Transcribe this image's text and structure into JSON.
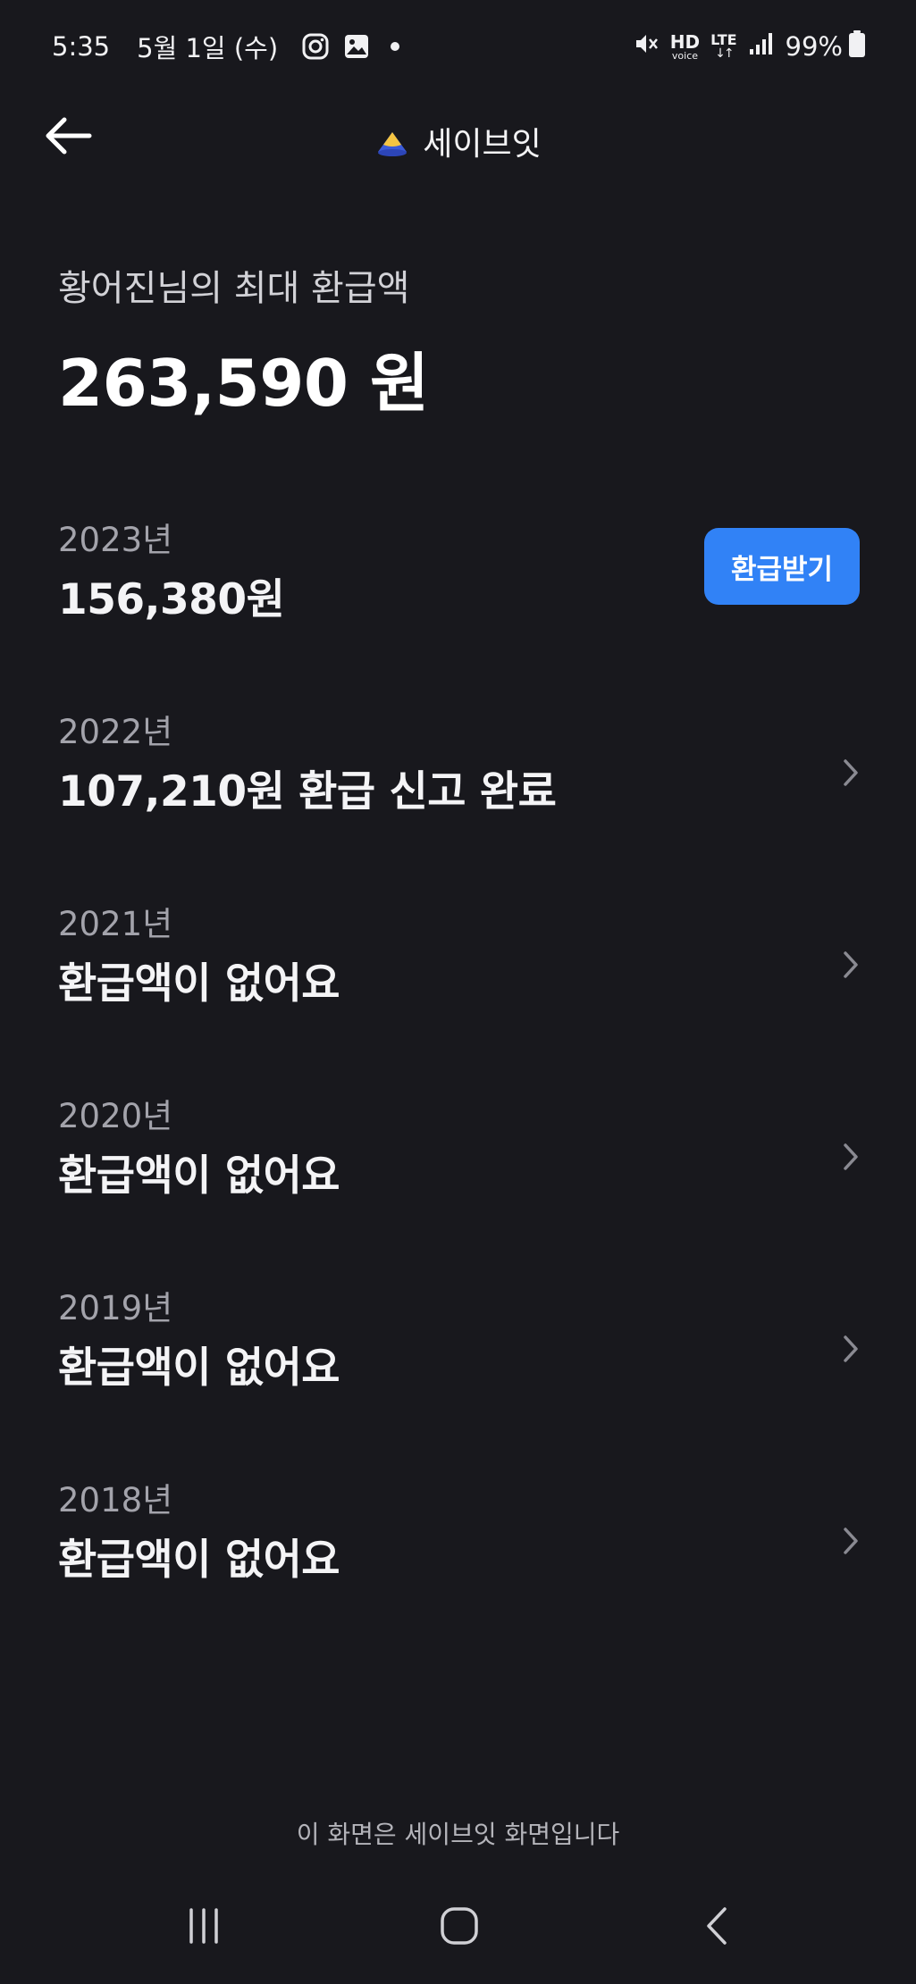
{
  "status_bar": {
    "time": "5:35",
    "date": "5월 1일 (수)",
    "battery": "99%",
    "hd_big": "HD",
    "hd_small": "voice",
    "lte": "LTE"
  },
  "header": {
    "title": "세이브잇"
  },
  "summary": {
    "label": "황어진님의 최대 환급액",
    "amount": "263,590 원"
  },
  "years": [
    {
      "year": "2023년",
      "status": "156,380원",
      "action_label": "환급받기"
    },
    {
      "year": "2022년",
      "status": "107,210원 환급 신고 완료"
    },
    {
      "year": "2021년",
      "status": "환급액이 없어요"
    },
    {
      "year": "2020년",
      "status": "환급액이 없어요"
    },
    {
      "year": "2019년",
      "status": "환급액이 없어요"
    },
    {
      "year": "2018년",
      "status": "환급액이 없어요"
    }
  ],
  "footer": {
    "note": "이 화면은 세이브잇 화면입니다"
  },
  "colors": {
    "background": "#18181d",
    "accent": "#3182f6"
  }
}
